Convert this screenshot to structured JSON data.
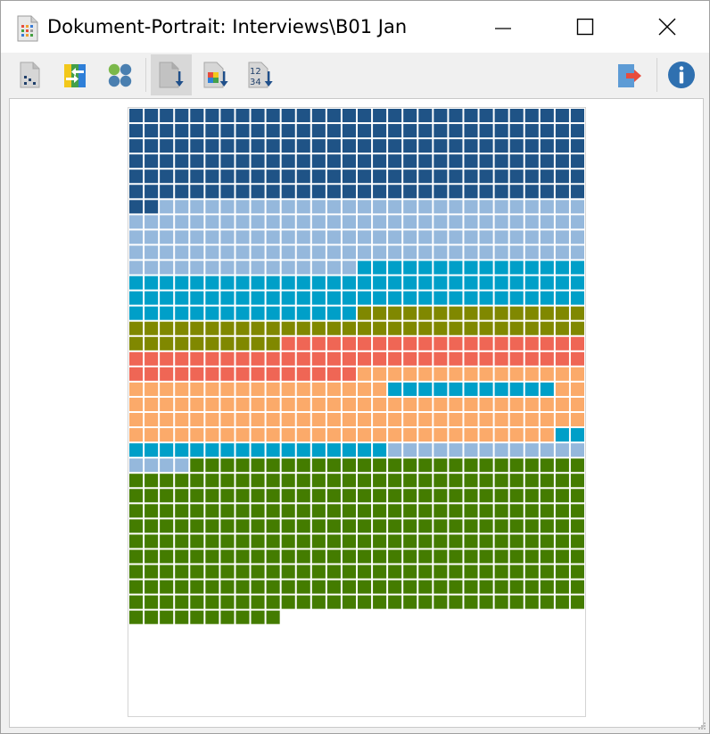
{
  "window": {
    "title": "Dokument-Portrait: Interviews\\B01 Jan",
    "app_icon": "document-portrait-icon",
    "controls": [
      "minimize-icon",
      "maximize-icon",
      "close-icon"
    ]
  },
  "toolbar": {
    "buttons": [
      {
        "icon": "document-grid-icon"
      },
      {
        "icon": "code-exchange-icon"
      },
      {
        "icon": "circles-icon"
      },
      {
        "icon": "sort-down-icon",
        "active": true
      },
      {
        "icon": "sort-by-color-icon"
      },
      {
        "icon": "sort-numeric-icon"
      },
      {
        "icon": "export-icon"
      },
      {
        "icon": "info-icon"
      }
    ]
  },
  "portrait": {
    "columns": 30,
    "rows": 40,
    "colors": {
      "A": "#1f5386",
      "B": "#95b8dc",
      "C": "#009fc8",
      "D": "#808800",
      "E": "#ef6655",
      "F": "#fbaa6a",
      "G": "#447c00"
    },
    "segments": [
      [
        "A",
        182
      ],
      [
        "B",
        133
      ],
      [
        "C",
        90
      ],
      [
        "D",
        55
      ],
      [
        "E",
        65
      ],
      [
        "F",
        32
      ],
      [
        "C",
        11
      ],
      [
        "F",
        90
      ],
      [
        "C",
        19
      ],
      [
        "B",
        17
      ],
      [
        "G",
        306
      ]
    ]
  }
}
